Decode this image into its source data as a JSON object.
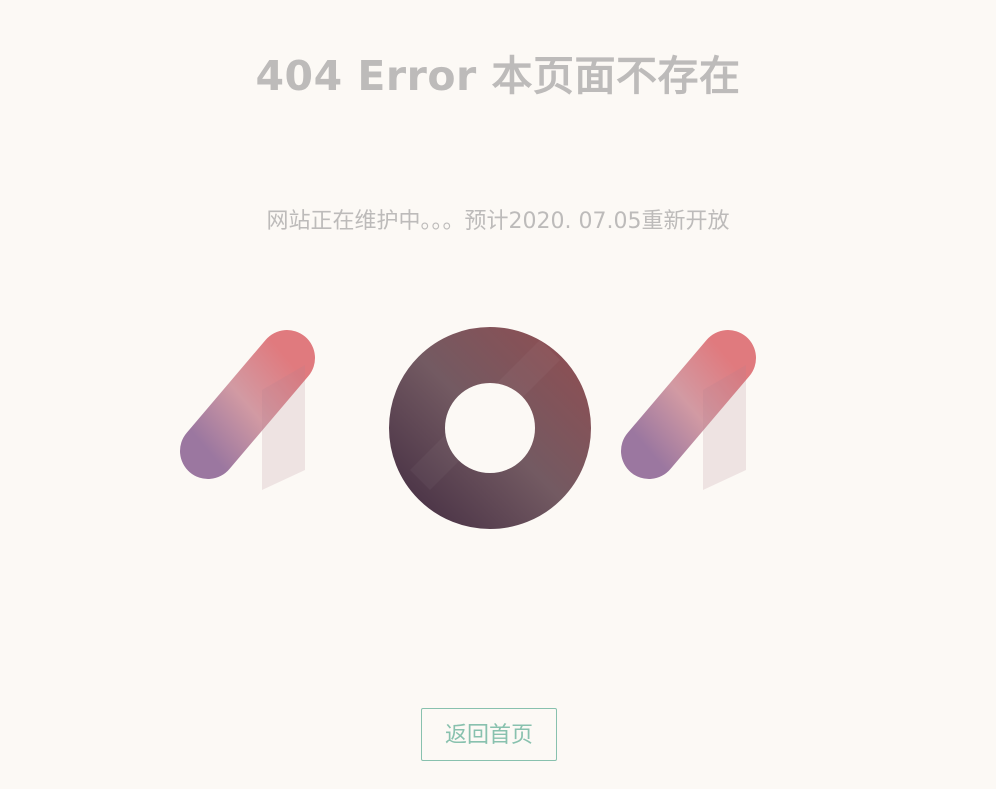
{
  "page": {
    "title": "404 Error 本页面不存在",
    "message": "网站正在维护中。。。预计2020. 07.05重新开放",
    "illustration_text": "404",
    "home_button_label": "返回首页"
  },
  "colors": {
    "background": "#fcf9f5",
    "text_muted": "#bdbbba",
    "button_accent": "#88c1ae",
    "four_top": "#e07a7e",
    "four_bottom": "#9b77a0",
    "zero_light": "#8a5055",
    "zero_dark": "#4d3648"
  }
}
